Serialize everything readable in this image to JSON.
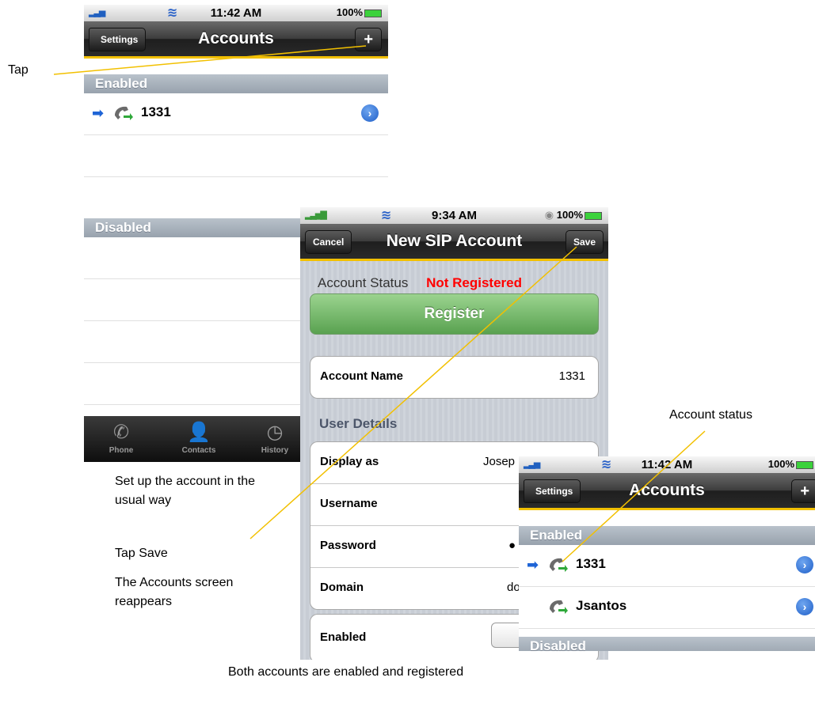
{
  "annotations": {
    "tap": "Tap",
    "setup": "Set up the account in the usual way",
    "tap_save": "Tap Save",
    "reappears": "The Accounts screen reappears",
    "account_status": "Account status",
    "both_enabled": "Both accounts are enabled and registered"
  },
  "screen1": {
    "status": {
      "time": "11:42 AM",
      "battery": "100%"
    },
    "nav": {
      "back": "Settings",
      "title": "Accounts",
      "add": "+"
    },
    "enabled_header": "Enabled",
    "accounts": [
      "1331"
    ],
    "disabled_header": "Disabled",
    "tabs": [
      "Phone",
      "Contacts",
      "History"
    ]
  },
  "screen2": {
    "status": {
      "time": "9:34 AM",
      "battery": "100%"
    },
    "nav": {
      "cancel": "Cancel",
      "title": "New SIP Account",
      "save": "Save"
    },
    "account_status_label": "Account Status",
    "account_status_value": "Not Registered",
    "register": "Register",
    "account_name_label": "Account Name",
    "account_name_value": "1331",
    "user_details_header": "User Details",
    "display_as_label": "Display as",
    "display_as_value": "Josep",
    "username_label": "Username",
    "password_label": "Password",
    "password_value": "●",
    "domain_label": "Domain",
    "domain_value": "dom",
    "enabled_label": "Enabled",
    "status_color": "#ff0000"
  },
  "screen3": {
    "status": {
      "time": "11:42 AM",
      "battery": "100%"
    },
    "nav": {
      "back": "Settings",
      "title": "Accounts",
      "add": "+"
    },
    "enabled_header": "Enabled",
    "accounts": [
      "1331",
      "Jsantos"
    ],
    "disabled_header": "Disabled"
  },
  "colors": {
    "accent_line": "#f2c000",
    "nav_dark": "#2a2a2a",
    "link_blue": "#1e64d6"
  }
}
